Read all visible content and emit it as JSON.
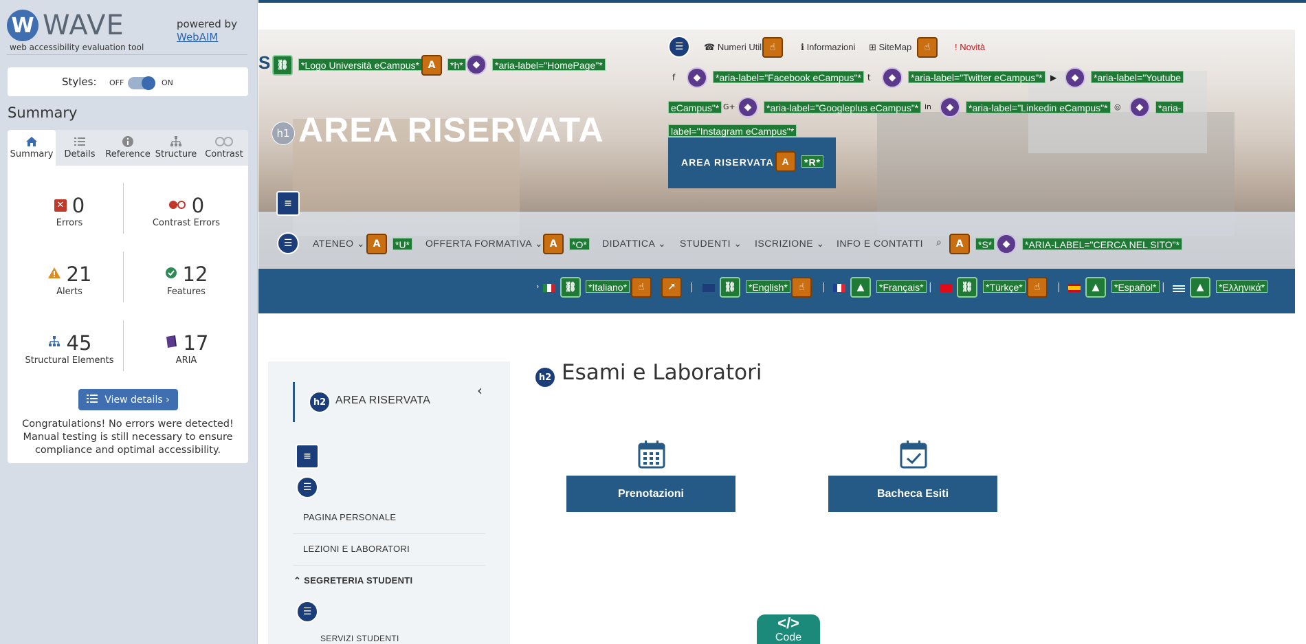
{
  "wave": {
    "logo_text": "WAVE",
    "tagline": "web accessibility evaluation tool",
    "powered_by": "powered by",
    "webaim_link": "WebAIM",
    "styles_label": "Styles:",
    "styles_off": "OFF",
    "styles_on": "ON",
    "summary_heading": "Summary",
    "tabs": [
      {
        "label": "Summary",
        "icon": "home-icon"
      },
      {
        "label": "Details",
        "icon": "list-icon"
      },
      {
        "label": "Reference",
        "icon": "info-icon"
      },
      {
        "label": "Structure",
        "icon": "structure-icon"
      },
      {
        "label": "Contrast",
        "icon": "contrast-icon"
      }
    ],
    "stats": {
      "errors": {
        "value": "0",
        "label": "Errors"
      },
      "contrast_errors": {
        "value": "0",
        "label": "Contrast Errors"
      },
      "alerts": {
        "value": "21",
        "label": "Alerts"
      },
      "features": {
        "value": "12",
        "label": "Features"
      },
      "structural": {
        "value": "45",
        "label": "Structural Elements"
      },
      "aria": {
        "value": "17",
        "label": "ARIA"
      }
    },
    "view_details": "View details ›",
    "congrats": "Congratulations! No errors were detected! Manual testing is still necessary to ensure compliance and optimal accessibility."
  },
  "site": {
    "logo_label": "*Logo Università eCampus*",
    "h_label": "*h*",
    "home_aria": "*aria-label=\"HomePage\"*",
    "top_links": [
      "Numeri Utili",
      "Informazioni",
      "SiteMap",
      "Novità"
    ],
    "social": {
      "facebook": "*aria-label=\"Facebook eCampus\"*",
      "twitter": "*aria-label=\"Twitter eCampus\"*",
      "youtube_a": "*aria-label=\"Youtube",
      "youtube_b": "eCampus\"*",
      "googleplus": "*aria-label=\"Googleplus eCampus\"*",
      "linkedin": "*aria-label=\"Linkedin eCampus\"*",
      "instagram_a": "*aria-",
      "instagram_b": "label=\"Instagram eCampus\"*"
    },
    "hero_title": "AREA RISERVATA",
    "h1_badge": "h1",
    "area_button": "AREA RISERVATA",
    "area_button_tag": "*R*",
    "nav": [
      "ATENEO",
      "OFFERTA FORMATIVA",
      "DIDATTICA",
      "STUDENTI",
      "ISCRIZIONE",
      "INFO E CONTATTI"
    ],
    "nav_tags": {
      "ateneo": "*U*",
      "offerta": "*O*",
      "search": "*S*",
      "search_aria": "*ARIA-LABEL=\"CERCA NEL SITO\"*"
    },
    "languages": [
      "*Italiano*",
      "*English*",
      "*Français*",
      "*Türkçe*",
      "*Español*",
      "*Ελληνικά*"
    ],
    "sidebar": {
      "h2_badge": "h2",
      "title": "AREA RISERVATA",
      "items": [
        "PAGINA PERSONALE",
        "LEZIONI E LABORATORI",
        "SEGRETERIA STUDENTI",
        "SERVIZI STUDENTI"
      ]
    },
    "main": {
      "h2_badge": "h2",
      "title": "Esami e Laboratori",
      "buttons": [
        "Prenotazioni",
        "Bacheca Esiti"
      ]
    },
    "code_tab": {
      "symbol": "</>",
      "label": "Code"
    }
  },
  "colors": {
    "accent": "#245a85",
    "wave_blue": "#3f6fb1",
    "link_green": "#1e7a34",
    "alert_orange": "#c96f12",
    "aria_purple": "#5b3a8c"
  }
}
